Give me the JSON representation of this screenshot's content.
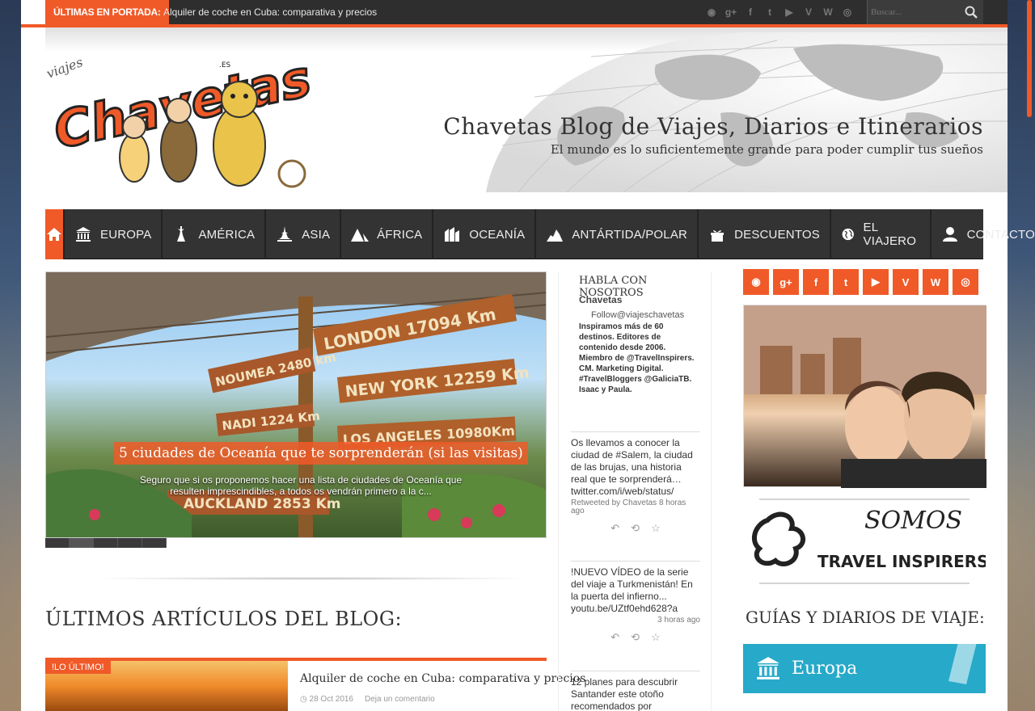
{
  "topbar": {
    "label": "ÚLTIMAS EN PORTADA:",
    "ticker": "Alquiler de coche en Cuba: comparativa y precios",
    "search_placeholder": "Buscar...",
    "social_icons": [
      "rss-icon",
      "google-plus-icon",
      "facebook-icon",
      "twitter-icon",
      "youtube-icon",
      "vimeo-icon",
      "wordpress-icon",
      "instagram-icon"
    ]
  },
  "header": {
    "title": "Chavetas Blog de Viajes, Diarios e Itinerarios",
    "tagline": "El mundo es lo suficientemente grande para poder cumplir tus sueños",
    "logo_text": "Chavetas",
    "logo_small": "viajes",
    "logo_domain": ".ES"
  },
  "nav": {
    "items": [
      "EUROPA",
      "AMÉRICA",
      "ASIA",
      "ÁFRICA",
      "OCEANÍA",
      "ANTÁRTIDA/POLAR",
      "DESCUENTOS",
      "EL VIAJERO",
      "CONTACTO"
    ]
  },
  "slider": {
    "caption": "5 ciudades de Oceanía que te sorprenderán (si las visitas)",
    "excerpt": "Seguro que si os proponemos hacer una lista de ciudades de Oceanía que resulten imprescindibles, a todos os vendrán primero a la c...",
    "signs": [
      "LONDON 17094 Km",
      "NOUMEA 2480 km",
      "NEW YORK 12259 Km",
      "NADI 1224 Km",
      "LOS ANGELES 10980Km",
      "AUCKLAND 2853 Km"
    ],
    "dot_count": 5,
    "active_dot": 1
  },
  "main": {
    "section_title": "ÚLTIMOS ARTÍCULOS DEL BLOG:",
    "article": {
      "badge": "!LO ÚLTIMO!",
      "title": "Alquiler de coche en Cuba: comparativa y precios",
      "date": "28 Oct 2016",
      "comments": "Deja un comentario"
    }
  },
  "twitter": {
    "heading": "HABLA CON NOSOTROS",
    "name": "Chavetas",
    "follow": "Follow@viajeschavetas",
    "bio": "Inspiramos más de 60 destinos. Editores de contenido desde 2006. Miembro de @TravelInspirers. CM. Marketing Digital. #TravelBloggers @GaliciaTB. Isaac y Paula.",
    "tweets": [
      {
        "text": "Os llevamos a conocer la ciudad de #Salem, la ciudad de las brujas, una historia real que te sorprenderá… twitter.com/i/web/status/",
        "meta": "Retweeted by Chavetas 8 horas ago"
      },
      {
        "text": "!NUEVO VÍDEO de la serie del viaje a Turkmenistán! En la puerta del infierno... youtu.be/UZtf0ehd628?a",
        "meta": "3 horas ago"
      },
      {
        "text": "12 planes para descubrir Santander este otoño recomendados por",
        "meta": ""
      }
    ]
  },
  "sidebar": {
    "social_icons": [
      "rss-icon",
      "google-plus-icon",
      "facebook-icon",
      "twitter-icon",
      "youtube-icon",
      "vimeo-icon",
      "wordpress-icon",
      "instagram-icon"
    ],
    "social_glyphs": [
      "◉",
      "g+",
      "f",
      "t",
      "▶",
      "V",
      "W",
      "◎"
    ],
    "travel_inspirers_top": "SOMOS",
    "travel_inspirers_bottom": "TRAVEL INSPIRERS",
    "guides_title": "GUÍAS Y DIARIOS DE VIAJE:",
    "guide_first": "Europa"
  },
  "colors": {
    "accent": "#f05a28",
    "nav_bg": "#333333",
    "teal": "#27a9c9"
  }
}
